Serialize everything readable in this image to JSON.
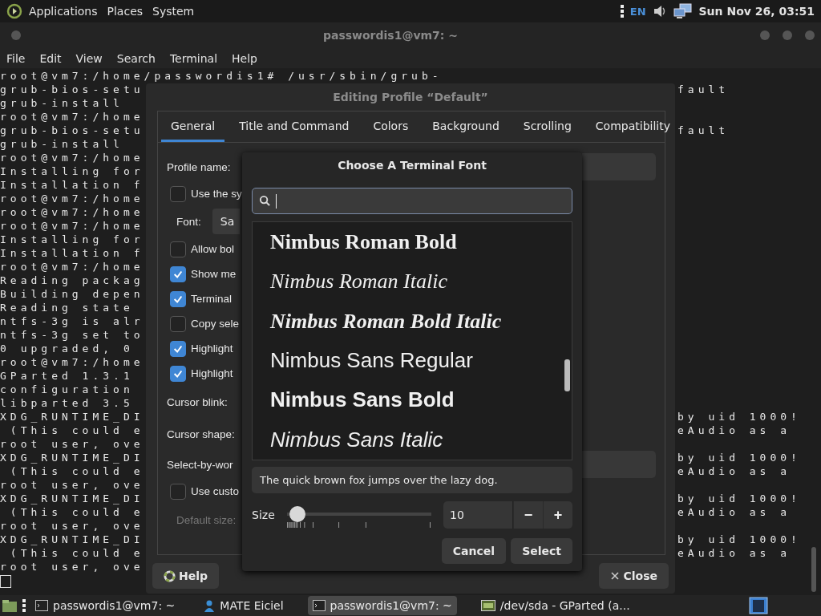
{
  "top_panel": {
    "menus": [
      "Applications",
      "Places",
      "System"
    ],
    "keyboard_layout": "EN",
    "clock": "Sun Nov 26, 03:51"
  },
  "terminal": {
    "title": "passwordis1@vm7: ~",
    "menu": [
      "File",
      "Edit",
      "View",
      "Search",
      "Terminal",
      "Help"
    ],
    "first_line": "root@vm7:/home/passwordis1# /usr/sbin/grub-",
    "lines": [
      {
        "left": "grub-bios-setu",
        "right": "fault"
      },
      {
        "left": "grub-install"
      },
      {
        "left": "root@vm7:/home"
      },
      {
        "left": "grub-bios-setu",
        "right": "fault"
      },
      {
        "left": "grub-install"
      },
      {
        "left": "root@vm7:/home"
      },
      {
        "left": "Installing for"
      },
      {
        "left": "Installation f"
      },
      {
        "left": "root@vm7:/home"
      },
      {
        "left": "root@vm7:/home"
      },
      {
        "left": "root@vm7:/home"
      },
      {
        "left": "Installing for"
      },
      {
        "left": "Installation f"
      },
      {
        "left": "root@vm7:/home"
      },
      {
        "left": "Reading packag"
      },
      {
        "left": "Building depen"
      },
      {
        "left": "Reading state"
      },
      {
        "left": "ntfs-3g is alr"
      },
      {
        "left": "ntfs-3g set to"
      },
      {
        "left": "0 upgraded, 0"
      },
      {
        "left": "root@vm7:/home"
      },
      {
        "left": "GParted 1.3.1"
      },
      {
        "left": "configuration"
      },
      {
        "left": "libparted 3.5"
      },
      {
        "left": "XDG_RUNTIME_DI",
        "right": "by uid 1000!"
      },
      {
        "left": " (This could e",
        "right": "eAudio as a"
      },
      {
        "left": "root user, ove"
      },
      {
        "left": "XDG_RUNTIME_DI",
        "right": "by uid 1000!"
      },
      {
        "left": " (This could e",
        "right": "eAudio as a"
      },
      {
        "left": "root user, ove"
      },
      {
        "left": "XDG_RUNTIME_DI",
        "right": "by uid 1000!"
      },
      {
        "left": " (This could e",
        "right": "eAudio as a"
      },
      {
        "left": "root user, ove"
      },
      {
        "left": "XDG_RUNTIME_DI",
        "right": "by uid 1000!"
      },
      {
        "left": " (This could e",
        "right": "eAudio as a"
      },
      {
        "left": "root user, ove"
      }
    ]
  },
  "profile_dialog": {
    "title": "Editing Profile “Default”",
    "tabs": [
      {
        "label": "General",
        "selected": true
      },
      {
        "label": "Title and Command",
        "selected": false
      },
      {
        "label": "Colors",
        "selected": false
      },
      {
        "label": "Background",
        "selected": false
      },
      {
        "label": "Scrolling",
        "selected": false
      },
      {
        "label": "Compatibility",
        "selected": false
      }
    ],
    "rows": [
      {
        "kind": "field",
        "label": "Profile name:"
      },
      {
        "kind": "check",
        "label": "Use the sy",
        "checked": false
      },
      {
        "kind": "font",
        "label": "Font:",
        "value": "Sa"
      },
      {
        "kind": "check",
        "label": "Allow bol",
        "checked": false
      },
      {
        "kind": "check",
        "label": "Show me",
        "checked": true
      },
      {
        "kind": "check",
        "label": "Terminal",
        "checked": true
      },
      {
        "kind": "check",
        "label": "Copy sele",
        "checked": false
      },
      {
        "kind": "check",
        "label": "Highlight",
        "checked": true
      },
      {
        "kind": "check",
        "label": "Highlight",
        "checked": true
      },
      {
        "kind": "label",
        "label": "Cursor blink:"
      },
      {
        "kind": "label",
        "label": "Cursor shape:"
      },
      {
        "kind": "field",
        "label": "Select-by-wor"
      },
      {
        "kind": "check",
        "label": "Use custo",
        "checked": false
      },
      {
        "kind": "label",
        "label": "Default size:",
        "disabled": true
      }
    ],
    "help": "Help",
    "close": "Close"
  },
  "font_dialog": {
    "title": "Choose A Terminal Font",
    "fonts": [
      {
        "name": "Nimbus Roman Bold",
        "serif": true,
        "bold": true,
        "italic": false
      },
      {
        "name": "Nimbus Roman Italic",
        "serif": true,
        "bold": false,
        "italic": true
      },
      {
        "name": "Nimbus Roman Bold Italic",
        "serif": true,
        "bold": true,
        "italic": true
      },
      {
        "name": "Nimbus Sans Regular",
        "serif": false,
        "bold": false,
        "italic": false
      },
      {
        "name": "Nimbus Sans Bold",
        "serif": false,
        "bold": true,
        "italic": false
      },
      {
        "name": "Nimbus Sans Italic",
        "serif": false,
        "bold": false,
        "italic": true
      }
    ],
    "preview": "The quick brown fox jumps over the lazy dog.",
    "size_label": "Size",
    "size_slider": {
      "level": 0.05
    },
    "size_value": "10",
    "minus": "−",
    "plus": "+",
    "cancel": "Cancel",
    "select": "Select"
  },
  "taskbar": [
    {
      "kind": "terminal",
      "label": "passwordis1@vm7: ~",
      "selected": false
    },
    {
      "kind": "person",
      "label": "MATE Eiciel",
      "selected": false
    },
    {
      "kind": "terminal",
      "label": "passwordis1@vm7: ~",
      "selected": true
    },
    {
      "kind": "disk",
      "label": "/dev/sda - GParted (a...",
      "selected": false
    }
  ]
}
